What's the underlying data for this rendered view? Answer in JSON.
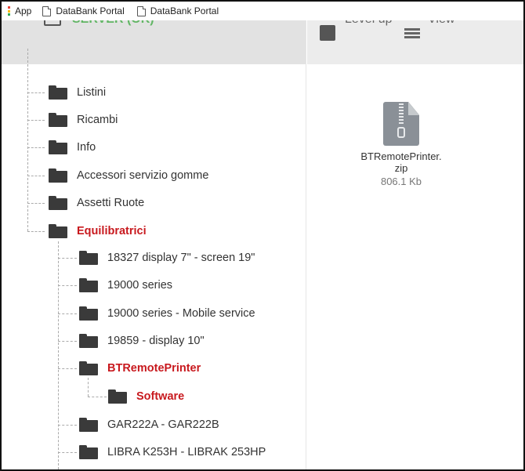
{
  "bookmarks_bar": {
    "apps_label": "App",
    "items": [
      {
        "label": "DataBank Portal"
      },
      {
        "label": "DataBank Portal"
      }
    ]
  },
  "colors": {
    "active": "#c8191e",
    "folder": "#3a3a3a",
    "server_green": "#4caf50",
    "apps_grip": [
      "#ea4335",
      "#fbbc05",
      "#34a853"
    ]
  },
  "tree": {
    "root_label": "SERVER (OK)",
    "items": [
      {
        "label": "Listini",
        "active": false
      },
      {
        "label": "Ricambi",
        "active": false
      },
      {
        "label": "Info",
        "active": false
      },
      {
        "label": "Accessori servizio gomme",
        "active": false
      },
      {
        "label": "Assetti Ruote",
        "active": false
      },
      {
        "label": "Equilibratrici",
        "active": true
      },
      {
        "label": "18327 display 7\" - screen 19\"",
        "active": false
      },
      {
        "label": "19000 series",
        "active": false
      },
      {
        "label": "19000 series - Mobile service",
        "active": false
      },
      {
        "label": "19859 - display 10\"",
        "active": false
      },
      {
        "label": "BTRemotePrinter",
        "active": true
      },
      {
        "label": "Software",
        "active": true
      },
      {
        "label": "GAR222A - GAR222B",
        "active": false
      },
      {
        "label": "LIBRA K253H - LIBRAK 253HP",
        "active": false
      }
    ]
  },
  "toolbar": {
    "level_up_label": "Level up",
    "view_label": "View"
  },
  "files": [
    {
      "name_line1": "BTRemotePrinter.",
      "name_line2": "zip",
      "size": "806.1 Kb",
      "icon": "zip-file-icon"
    }
  ]
}
